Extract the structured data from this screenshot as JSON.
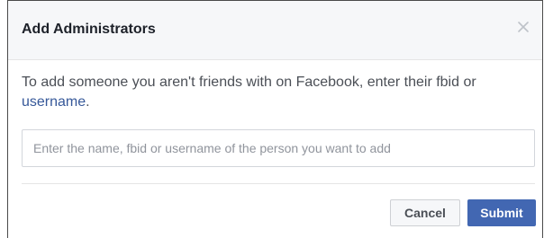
{
  "dialog": {
    "title": "Add Administrators",
    "close_icon": "close-icon"
  },
  "body": {
    "text_before_link": "To add someone you aren't friends with on Facebook, enter their fbid or ",
    "link_text": "username",
    "text_after_link": "."
  },
  "search": {
    "placeholder": "Enter the name, fbid or username of the person you want to add",
    "value": ""
  },
  "footer": {
    "cancel_label": "Cancel",
    "submit_label": "Submit"
  },
  "colors": {
    "link": "#365899",
    "primary_button": "#4267b2",
    "header_background": "#f6f7f9"
  }
}
